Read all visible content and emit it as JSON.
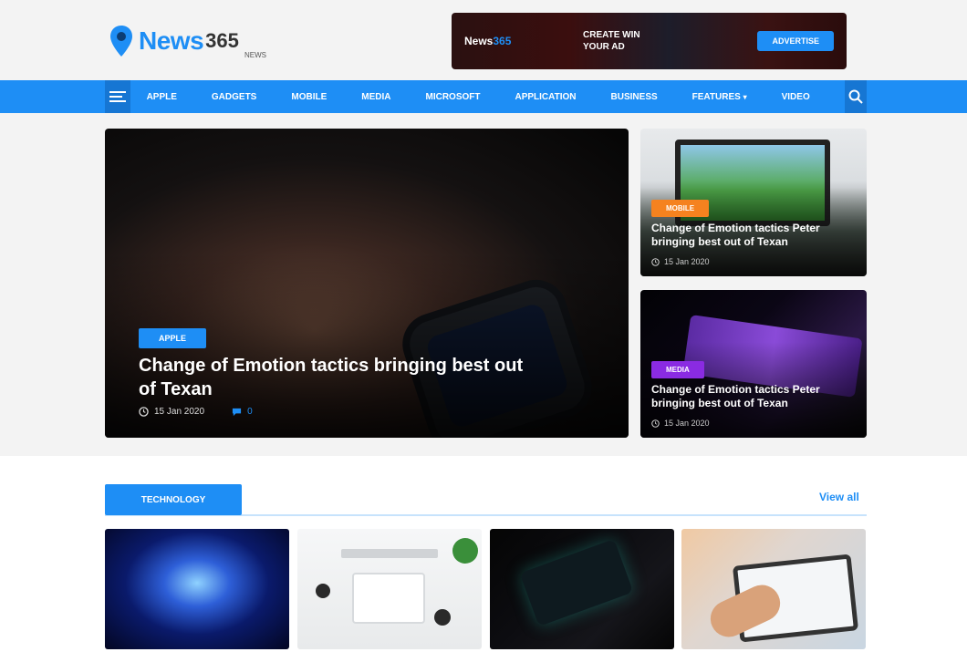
{
  "header": {
    "logo_text": "News",
    "logo_number": "365",
    "logo_tagline": "NEWS"
  },
  "banner": {
    "brand_main": "News",
    "brand_accent": "365",
    "headline_line1": "CREATE WIN",
    "headline_line2": "YOUR AD",
    "button_label": "ADVERTISE"
  },
  "nav": {
    "items": [
      {
        "label": "Apple"
      },
      {
        "label": "Gadgets"
      },
      {
        "label": "Mobile"
      },
      {
        "label": "Media"
      },
      {
        "label": "Microsoft"
      },
      {
        "label": "Application"
      },
      {
        "label": "Business"
      },
      {
        "label": "Features"
      },
      {
        "label": "Video"
      }
    ]
  },
  "featured": {
    "main": {
      "category": "APPLE",
      "title": "Change of Emotion tactics bringing best out of Texan",
      "date": "15 Jan 2020",
      "comments": "0"
    },
    "side": [
      {
        "category": "MOBILE",
        "title": "Change of Emotion tactics Peter bringing best out of Texan",
        "date": "15 Jan 2020"
      },
      {
        "category": "MEDIA",
        "title": "Change of Emotion tactics Peter bringing best out of Texan",
        "date": "15 Jan 2020"
      }
    ]
  },
  "section": {
    "tag_label": "Technology",
    "view_all_label": "View all"
  },
  "colors": {
    "accent": "#1e8ef5",
    "badge_orange": "#f5821f",
    "badge_purple": "#8a2be2"
  }
}
